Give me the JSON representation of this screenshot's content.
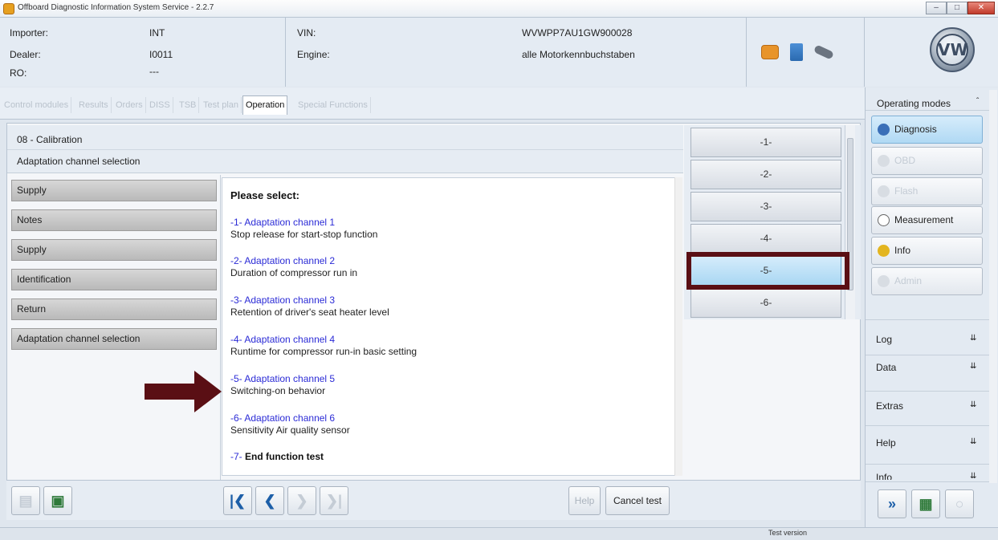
{
  "window": {
    "title": "Offboard Diagnostic Information System Service - 2.2.7",
    "buttons": [
      "–",
      "□",
      "✕"
    ]
  },
  "header": {
    "importer_label": "Importer:",
    "importer_value": "INT",
    "dealer_label": "Dealer:",
    "dealer_value": "I0011",
    "ro_label": "RO:",
    "ro_value": "---",
    "vin_label": "VIN:",
    "vin_value": "WVWPP7AU1GW900028",
    "engine_label": "Engine:",
    "engine_value": "alle Motorkennbuchstaben",
    "logo_text": "VW"
  },
  "tabs": [
    "Control modules",
    "Results",
    "Orders",
    "DISS",
    "TSB",
    "Test plan",
    "Operation",
    "Special Functions"
  ],
  "active_tab": "Operation",
  "breadcrumb": {
    "line1": "08 - Calibration",
    "line2": "Adaptation channel selection"
  },
  "nav_buttons": [
    "Supply",
    "Notes",
    "Supply",
    "Identification",
    "Return",
    "Adaptation channel selection"
  ],
  "content": {
    "heading": "Please select:",
    "options": [
      {
        "link": "-1- Adaptation channel 1",
        "desc": "Stop release for start-stop function"
      },
      {
        "link": "-2- Adaptation channel 2",
        "desc": "Duration of compressor run in"
      },
      {
        "link": "-3- Adaptation channel 3",
        "desc": "Retention of driver's seat heater level"
      },
      {
        "link": "-4- Adaptation channel 4",
        "desc": "Runtime for compressor run-in basic setting"
      },
      {
        "link": "-5- Adaptation channel 5",
        "desc": "Switching-on behavior"
      },
      {
        "link": "-6- Adaptation channel 6",
        "desc": "Sensitivity Air quality sensor"
      }
    ],
    "end_num": "-7-",
    "end_text": "End function test"
  },
  "number_buttons": [
    "-1-",
    "-2-",
    "-3-",
    "-4-",
    "-5-",
    "-6-"
  ],
  "bottom": {
    "help_label": "Help",
    "cancel_label": "Cancel test"
  },
  "sidebar": {
    "operating_modes": "Operating modes",
    "buttons": [
      "Diagnosis",
      "OBD",
      "Flash",
      "Measurement",
      "Info",
      "Admin"
    ],
    "sections": [
      "Log",
      "Data",
      "Extras",
      "Help",
      "Info"
    ]
  },
  "status": {
    "text": "Test version"
  },
  "colors": {
    "highlight": "#5a0f14",
    "link": "#2b2bd6",
    "nav_button": "#c4c4c4"
  }
}
